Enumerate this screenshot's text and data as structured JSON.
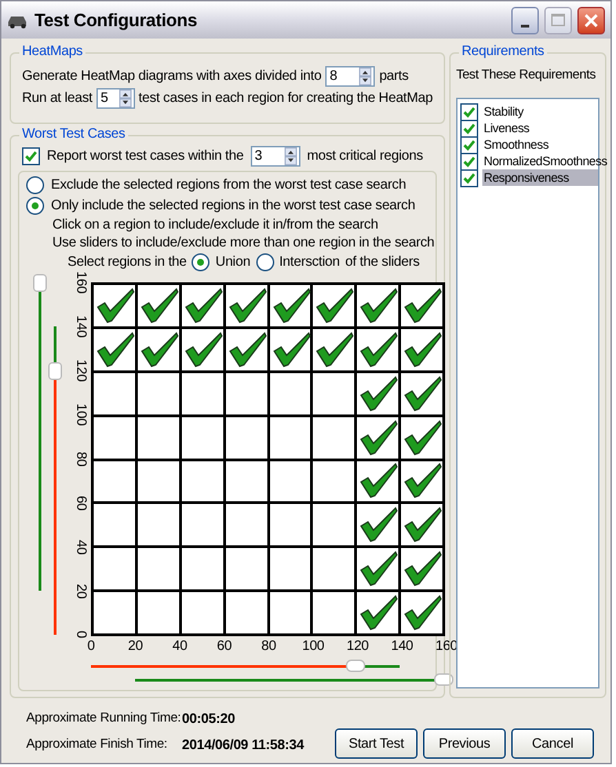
{
  "window": {
    "title": "Test Configurations"
  },
  "heatmaps": {
    "title": "HeatMaps",
    "line1": {
      "before": "Generate HeatMap diagrams with axes divided into",
      "value": "8",
      "after": "parts"
    },
    "line2": {
      "before": "Run at least",
      "value": "5",
      "after": "test cases in each region for creating the HeatMap"
    }
  },
  "worst": {
    "title": "Worst Test Cases",
    "report": {
      "checked": true,
      "before": "Report worst test cases within the",
      "value": "3",
      "after": "most critical regions"
    },
    "modes": [
      {
        "label": "Exclude the selected regions from the worst test case search",
        "selected": false
      },
      {
        "label": "Only include the selected regions in the worst test case search",
        "selected": true
      }
    ],
    "hints": [
      "Click on a region to include/exclude it in/from the search",
      "Use sliders to include/exclude more than one region in the search"
    ],
    "combine": {
      "before": "Select regions in the",
      "after": "of the sliders",
      "options": [
        {
          "label": "Union",
          "selected": true
        },
        {
          "label": "Intersction",
          "selected": false
        }
      ]
    },
    "grid": {
      "y_ticks": [
        "160",
        "140",
        "120",
        "100",
        "80",
        "60",
        "40",
        "20",
        "0"
      ],
      "x_ticks": [
        "0",
        "20",
        "40",
        "60",
        "80",
        "100",
        "120",
        "140",
        "160"
      ],
      "rows": [
        [
          true,
          true,
          true,
          true,
          true,
          true,
          true,
          true
        ],
        [
          true,
          true,
          true,
          true,
          true,
          true,
          true,
          true
        ],
        [
          false,
          false,
          false,
          false,
          false,
          false,
          true,
          true
        ],
        [
          false,
          false,
          false,
          false,
          false,
          false,
          true,
          true
        ],
        [
          false,
          false,
          false,
          false,
          false,
          false,
          true,
          true
        ],
        [
          false,
          false,
          false,
          false,
          false,
          false,
          true,
          true
        ],
        [
          false,
          false,
          false,
          false,
          false,
          false,
          true,
          true
        ],
        [
          false,
          false,
          false,
          false,
          false,
          false,
          true,
          true
        ]
      ]
    },
    "vertical_sliders": [
      {
        "kind": "single",
        "level": 1
      },
      {
        "kind": "split",
        "level": 0.75
      }
    ],
    "horizontal_sliders": [
      {
        "kind": "split",
        "level": 0.75
      },
      {
        "kind": "single",
        "level": 1
      }
    ]
  },
  "requirements": {
    "title": "Requirements",
    "caption": "Test These Requirements",
    "items": [
      {
        "label": "Stability",
        "checked": true,
        "selected": false
      },
      {
        "label": "Liveness",
        "checked": true,
        "selected": false
      },
      {
        "label": "Smoothness",
        "checked": true,
        "selected": false
      },
      {
        "label": "NormalizedSmoothness",
        "checked": true,
        "selected": false
      },
      {
        "label": "Responsiveness",
        "checked": true,
        "selected": true
      }
    ]
  },
  "times": [
    {
      "label": "Approximate Running Time:",
      "value": "00:05:20"
    },
    {
      "label": "Approximate Finish Time:",
      "value": "2014/06/09 11:58:34"
    }
  ],
  "buttons": [
    "Start Test",
    "Previous",
    "Cancel"
  ]
}
